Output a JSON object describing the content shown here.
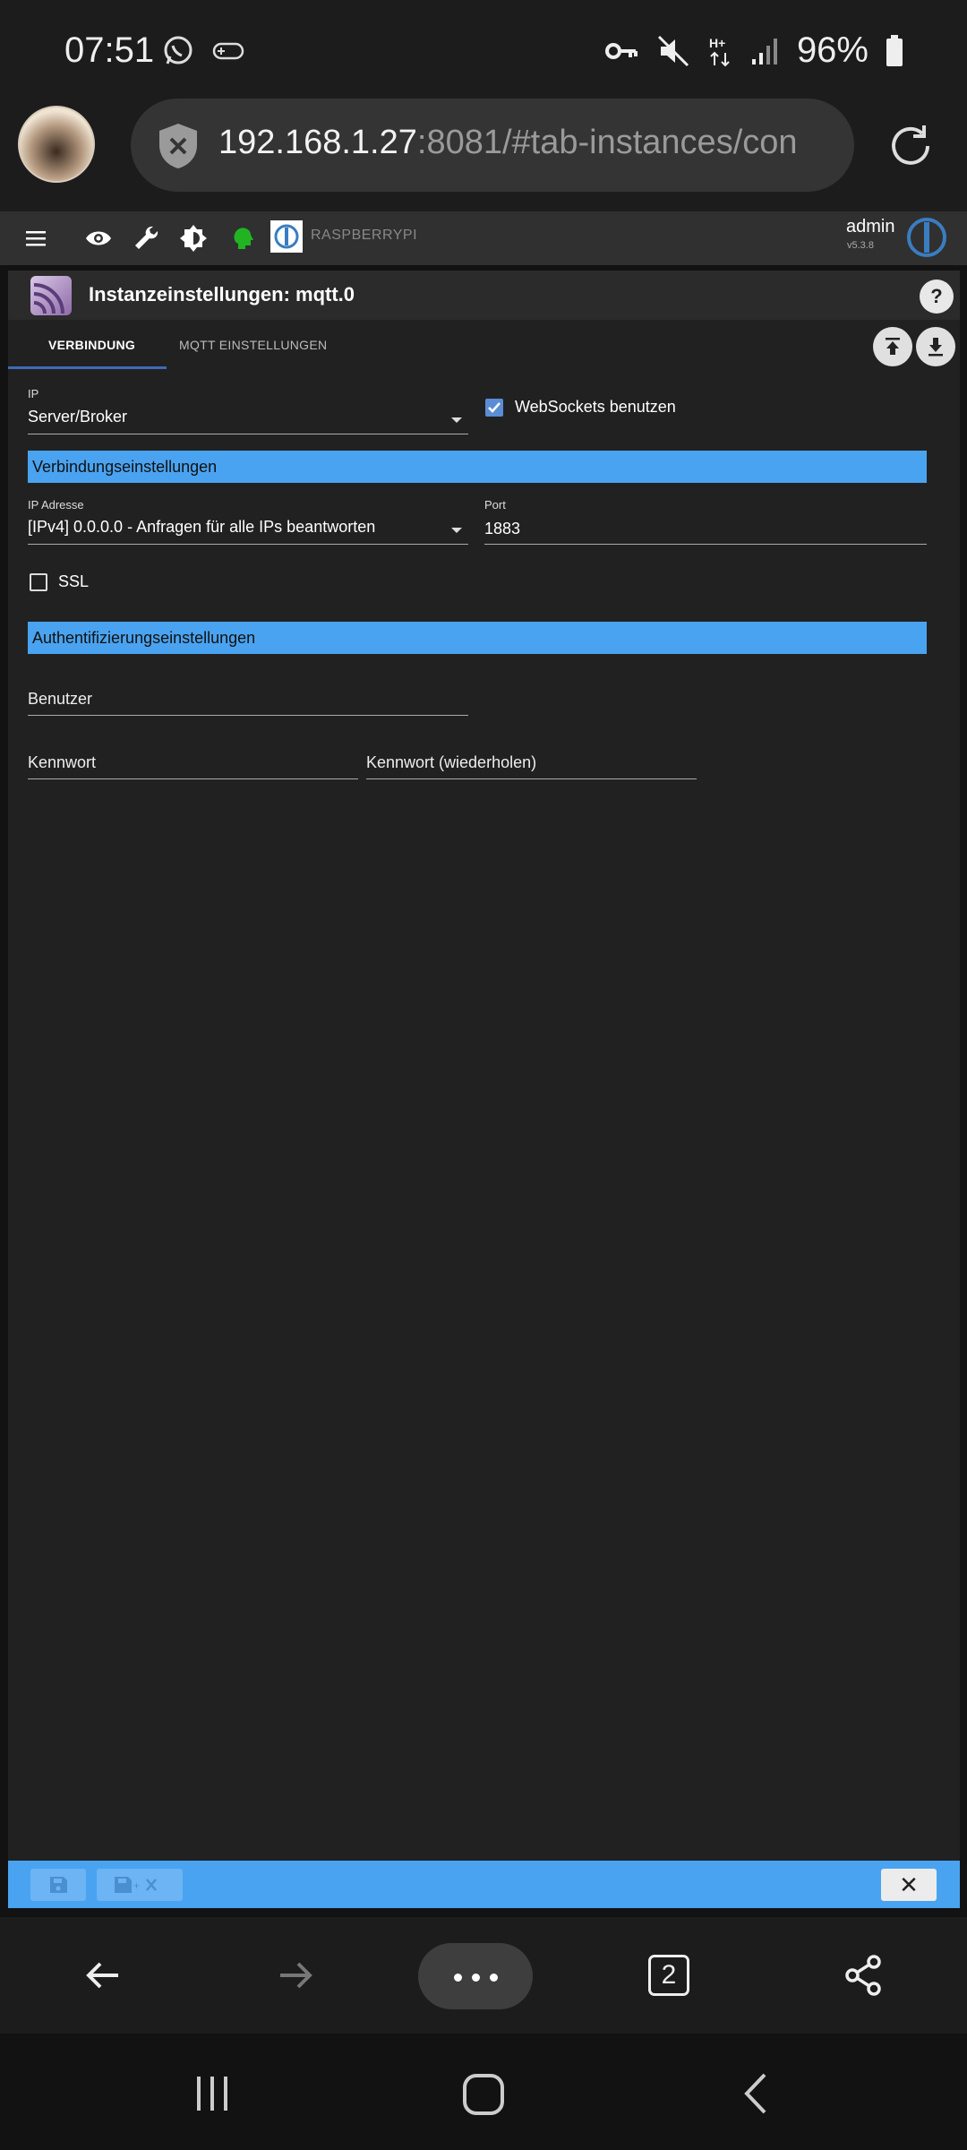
{
  "status_bar": {
    "time": "07:51",
    "battery": "96%",
    "icons": [
      "whatsapp-icon",
      "game-icon",
      "vpn-key-icon",
      "mute-icon",
      "data-hplus-icon",
      "signal-icon",
      "battery-icon"
    ]
  },
  "browser": {
    "url_host": "192.168.1.27",
    "url_rest": ":8081/#tab-instances/con",
    "tab_count": "2"
  },
  "app_toolbar": {
    "host": "RASPBERRYPI",
    "user": "admin",
    "version": "v5.3.8"
  },
  "dialog": {
    "title": "Instanzeinstellungen: mqtt.0",
    "help": "?",
    "tabs": [
      {
        "label": "VERBINDUNG",
        "active": true
      },
      {
        "label": "MQTT EINSTELLUNGEN",
        "active": false
      }
    ],
    "ip_label": "IP",
    "ip_value": "Server/Broker",
    "websockets_label": "WebSockets benutzen",
    "websockets_checked": true,
    "section_connection": "Verbindungseinstellungen",
    "ip_address_label": "IP Adresse",
    "ip_address_value": "[IPv4] 0.0.0.0 - Anfragen für alle IPs beantworten",
    "port_label": "Port",
    "port_value": "1883",
    "ssl_label": "SSL",
    "ssl_checked": false,
    "section_auth": "Authentifizierungseinstellungen",
    "user_placeholder": "Benutzer",
    "password_placeholder": "Kennwort",
    "password_repeat_placeholder": "Kennwort (wiederholen)",
    "close_symbol": "✕"
  },
  "colors": {
    "accent": "#4aa3f0",
    "tab_underline": "#3f6ab8",
    "background": "#212121"
  }
}
